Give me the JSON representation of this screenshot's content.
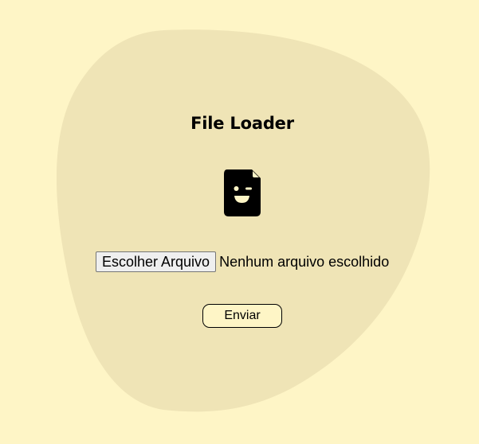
{
  "app": {
    "title": "File Loader"
  },
  "file_input": {
    "button_label": "Escolher Arquivo",
    "status_text": "Nenhum arquivo escolhido"
  },
  "actions": {
    "submit_label": "Enviar"
  },
  "icons": {
    "file": "winking-file-icon"
  },
  "colors": {
    "background": "#fef5c6",
    "blob": "#efe4b6",
    "icon": "#000000",
    "icon_face": "#fef5c6"
  }
}
